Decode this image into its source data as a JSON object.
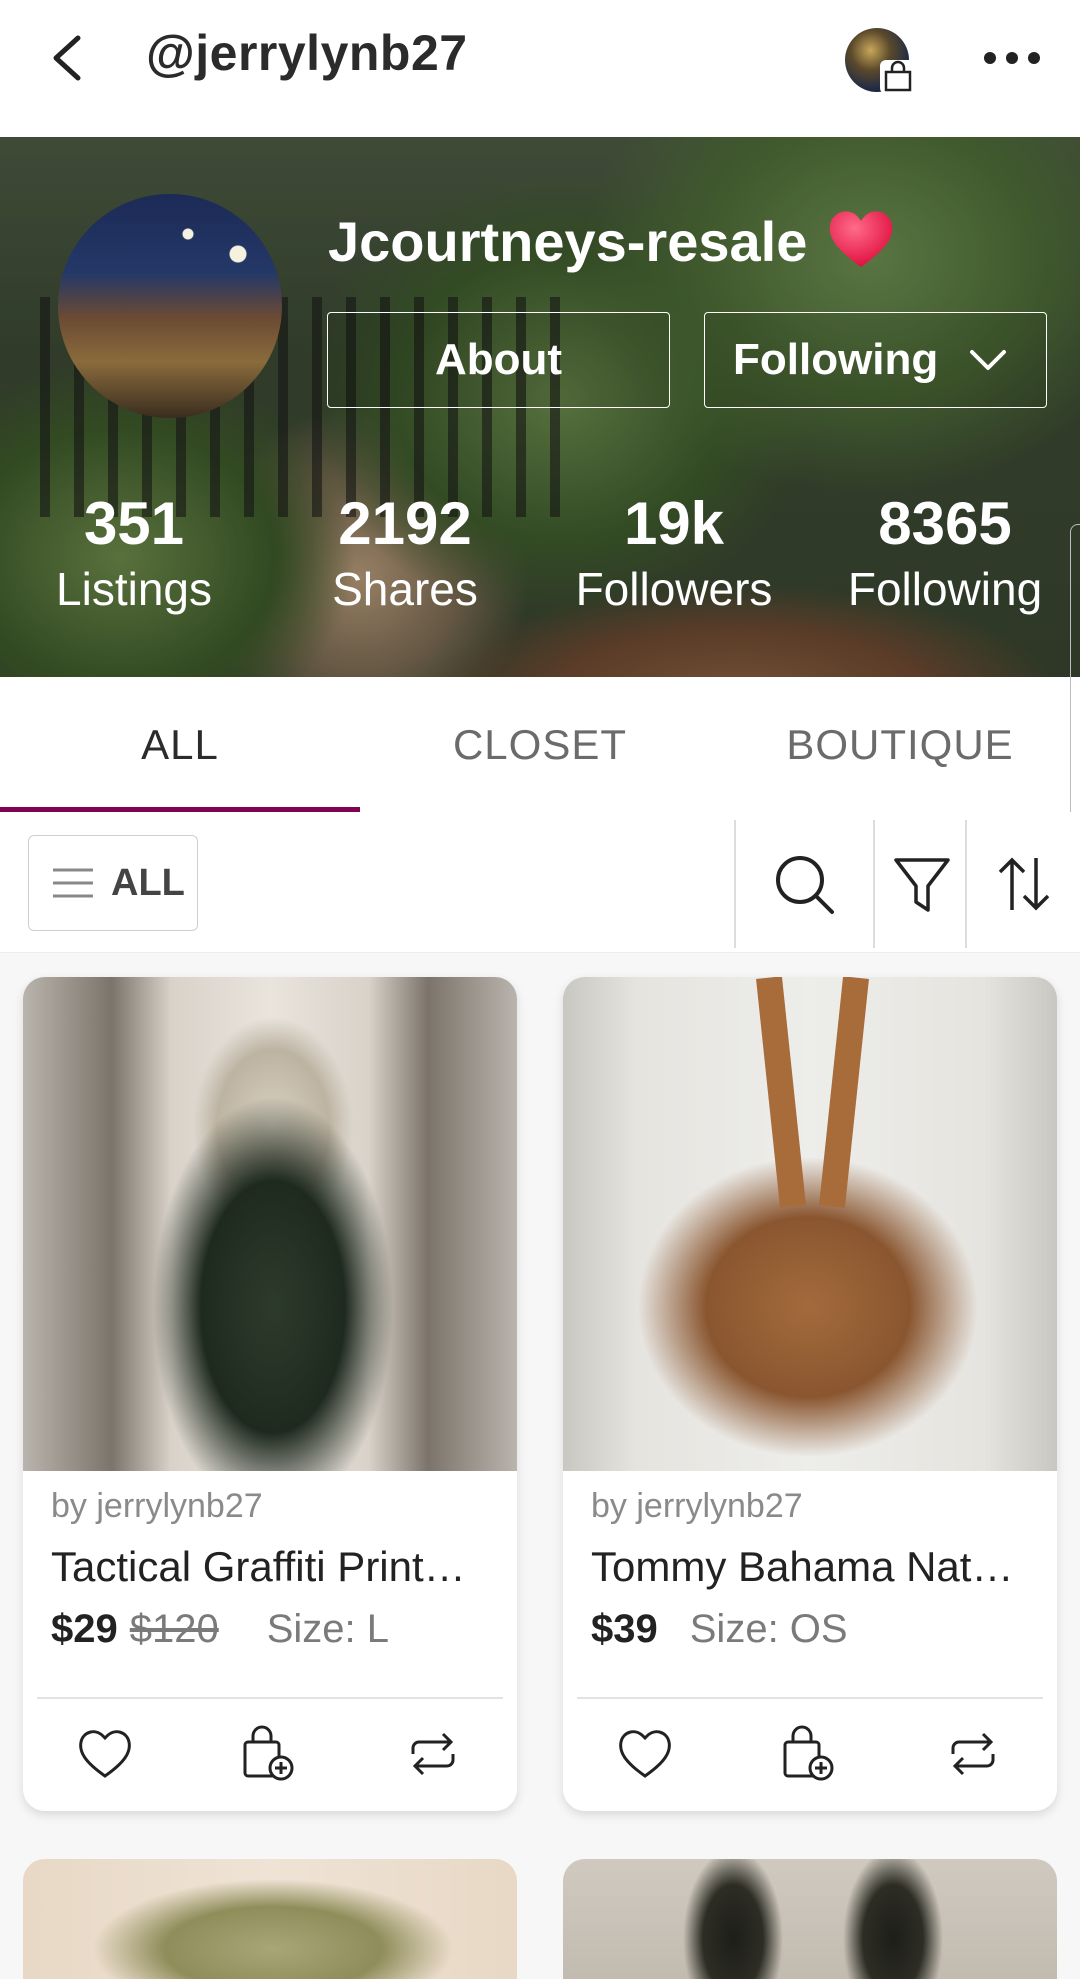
{
  "topbar": {
    "title": "@jerrylynb27",
    "back_icon": "chevron-left-icon",
    "more_icon": "more-horizontal-icon",
    "shop_avatar_icon": "shopping-bag-icon"
  },
  "profile": {
    "shop_name": "Jcourtneys-resale",
    "heart_emoji": "❤️",
    "about_label": "About",
    "following_label": "Following",
    "stats": [
      {
        "value": "351",
        "label": "Listings"
      },
      {
        "value": "2192",
        "label": "Shares"
      },
      {
        "value": "19k",
        "label": "Followers"
      },
      {
        "value": "8365",
        "label": "Following"
      }
    ]
  },
  "tabs": [
    {
      "label": "ALL",
      "active": true
    },
    {
      "label": "CLOSET",
      "active": false
    },
    {
      "label": "BOUTIQUE",
      "active": false
    }
  ],
  "filter": {
    "category_label": "ALL",
    "icons": [
      "search-icon",
      "filter-icon",
      "sort-icon"
    ]
  },
  "listings": [
    {
      "seller": "by jerrylynb27",
      "title": "Tactical Graffiti Print…",
      "price": "$29",
      "original_price": "$120",
      "size": "Size: L"
    },
    {
      "seller": "by jerrylynb27",
      "title": "Tommy Bahama Nat…",
      "price": "$39",
      "original_price": "",
      "size": "Size: OS"
    }
  ],
  "colors": {
    "accent": "#7f0353",
    "text": "#222222",
    "muted": "#7a7a7a",
    "background": "#f7f7f7"
  }
}
